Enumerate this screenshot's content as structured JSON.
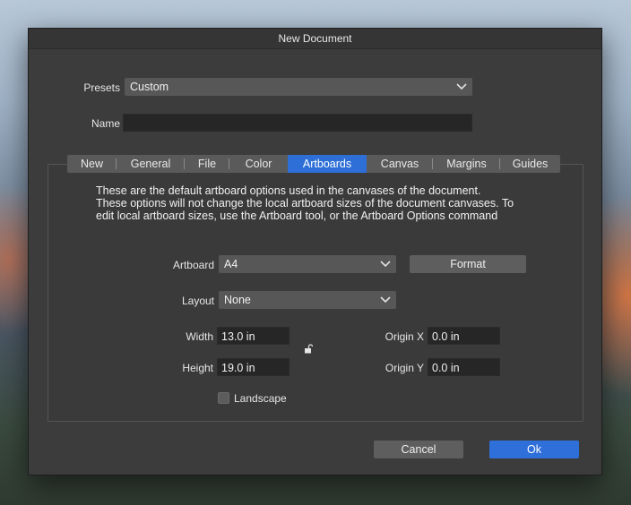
{
  "dialog": {
    "title": "New Document"
  },
  "presets": {
    "label": "Presets",
    "value": "Custom"
  },
  "name": {
    "label": "Name",
    "value": ""
  },
  "tabs": [
    {
      "label": "New",
      "active": false
    },
    {
      "label": "General",
      "active": false
    },
    {
      "label": "File",
      "active": false
    },
    {
      "label": "Color",
      "active": false
    },
    {
      "label": "Artboards",
      "active": true
    },
    {
      "label": "Canvas",
      "active": false
    },
    {
      "label": "Margins",
      "active": false
    },
    {
      "label": "Guides",
      "active": false
    }
  ],
  "description": [
    "These are the default artboard options used in the canvases of the document.",
    "These options will not change the local artboard sizes of the document canvases. To",
    "edit local artboard sizes, use the Artboard tool, or the Artboard Options command"
  ],
  "artboard": {
    "label": "Artboard",
    "value": "A4",
    "format_button": "Format"
  },
  "layout": {
    "label": "Layout",
    "value": "None"
  },
  "width": {
    "label": "Width",
    "value": "13.0 in"
  },
  "height": {
    "label": "Height",
    "value": "19.0 in"
  },
  "origin_x": {
    "label": "Origin X",
    "value": "0.0 in"
  },
  "origin_y": {
    "label": "Origin Y",
    "value": "0.0 in"
  },
  "landscape": {
    "label": "Landscape",
    "checked": false
  },
  "buttons": {
    "cancel": "Cancel",
    "ok": "Ok"
  },
  "icons": {
    "dropdown": "chevron-down-icon",
    "lock": "unlock-icon"
  },
  "colors": {
    "accent": "#2d6fd6",
    "dialog_bg": "#3c3c3c"
  }
}
